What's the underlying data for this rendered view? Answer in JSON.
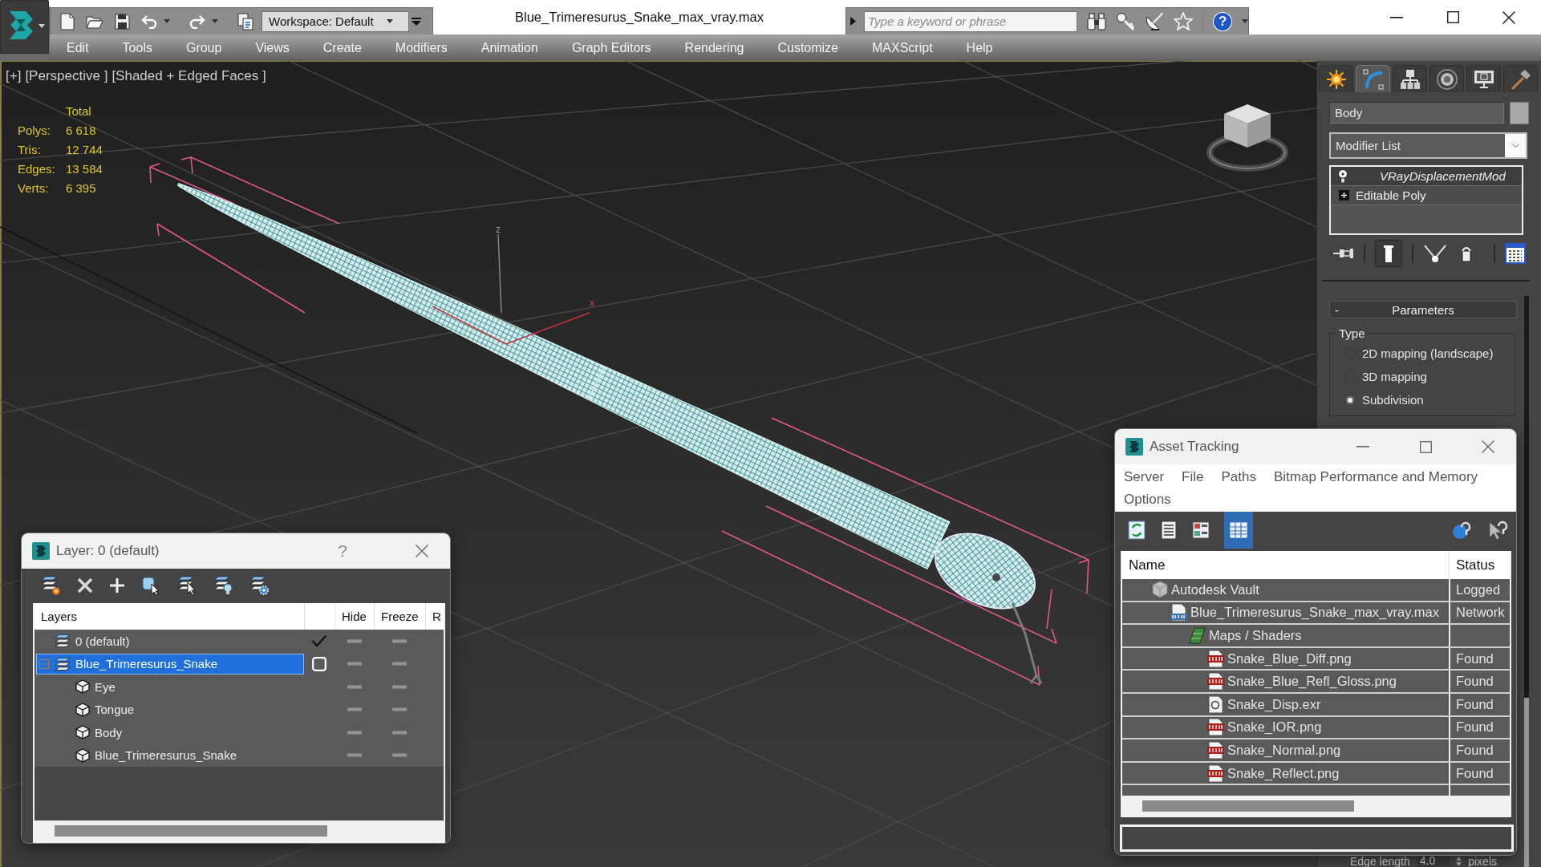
{
  "app": {
    "title": "Blue_Trimeresurus_Snake_max_vray.max",
    "workspace": "Workspace: Default",
    "search_placeholder": "Type a keyword or phrase",
    "help": "?"
  },
  "menu": [
    "Edit",
    "Tools",
    "Group",
    "Views",
    "Create",
    "Modifiers",
    "Animation",
    "Graph Editors",
    "Rendering",
    "Customize",
    "MAXScript",
    "Help"
  ],
  "viewport": {
    "labels": [
      "[+]",
      "[Perspective ]",
      "[Shaded + Edged Faces ]"
    ],
    "stats_header": "Total",
    "stats": [
      {
        "label": "Polys:",
        "value": "6 618"
      },
      {
        "label": "Tris:",
        "value": "12 744"
      },
      {
        "label": "Edges:",
        "value": "13 584"
      },
      {
        "label": "Verts:",
        "value": "6 395"
      }
    ],
    "axis_labels": [
      "z",
      "x"
    ]
  },
  "command_panel": {
    "tabs": [
      {
        "kind": "create",
        "selected": false
      },
      {
        "kind": "modify",
        "selected": true
      },
      {
        "kind": "hierarchy",
        "selected": false
      },
      {
        "kind": "motion",
        "selected": false
      },
      {
        "kind": "display",
        "selected": false
      },
      {
        "kind": "utilities",
        "selected": false
      }
    ],
    "object_name": "Body",
    "modifier_list": "Modifier List",
    "stack": [
      {
        "label": "VRayDisplacementMod",
        "kind": "modifier"
      },
      {
        "label": "Editable Poly",
        "kind": "base"
      }
    ],
    "rollout": {
      "toggle": "-",
      "title": "Parameters",
      "group": "Type",
      "options": [
        {
          "label": "2D mapping (landscape)",
          "selected": false
        },
        {
          "label": "3D mapping",
          "selected": false
        },
        {
          "label": "Subdivision",
          "selected": true
        }
      ]
    },
    "edge_length": {
      "label": "Edge length",
      "value": "4.0",
      "unit": "pixels"
    }
  },
  "layer_window": {
    "title": "Layer: 0 (default)",
    "help": "?",
    "columns": {
      "name": "Layers",
      "hide": "Hide",
      "freeze": "Freeze",
      "column_5": "R"
    },
    "layers": [
      {
        "name": "0 (default)",
        "kind": "layer",
        "current": true,
        "selected": false,
        "hidden": false,
        "frozen": false
      },
      {
        "name": "Blue_Trimeresurus_Snake",
        "kind": "layer",
        "current": false,
        "selected": true,
        "expanded": true,
        "hidden": false,
        "frozen": false,
        "children": [
          {
            "name": "Eye",
            "kind": "object",
            "selected": false,
            "hidden": false,
            "frozen": false
          },
          {
            "name": "Tongue",
            "kind": "object",
            "selected": false,
            "hidden": false,
            "frozen": false
          },
          {
            "name": "Body",
            "kind": "object",
            "selected": false,
            "hidden": false,
            "frozen": false
          },
          {
            "name": "Blue_Trimeresurus_Snake",
            "kind": "object",
            "selected": false,
            "hidden": false,
            "frozen": false
          }
        ]
      }
    ]
  },
  "asset_window": {
    "title": "Asset Tracking",
    "menu": [
      "Server",
      "File",
      "Paths",
      "Bitmap Performance and Memory",
      "Options"
    ],
    "toolbar": [
      {
        "kind": "refresh",
        "selected": false
      },
      {
        "kind": "list",
        "selected": false
      },
      {
        "kind": "thumbnails",
        "selected": false
      },
      {
        "kind": "table",
        "selected": true
      }
    ],
    "columns": {
      "name": "Name",
      "status": "Status"
    },
    "assets": [
      {
        "name": "Autodesk Vault",
        "status": "Logged",
        "kind": "vault",
        "children": [
          {
            "name": "Blue_Trimeresurus_Snake_max_vray.max",
            "status": "Network",
            "kind": "max",
            "children": [
              {
                "name": "Maps / Shaders",
                "kind": "maps",
                "children": [
                  {
                    "name": "Snake_Blue_Diff.png",
                    "status": "Found",
                    "kind": "png"
                  },
                  {
                    "name": "Snake_Blue_Refl_Gloss.png",
                    "status": "Found",
                    "kind": "png"
                  },
                  {
                    "name": "Snake_Disp.exr",
                    "status": "Found",
                    "kind": "exr"
                  },
                  {
                    "name": "Snake_IOR.png",
                    "status": "Found",
                    "kind": "png"
                  },
                  {
                    "name": "Snake_Normal.png",
                    "status": "Found",
                    "kind": "png"
                  },
                  {
                    "name": "Snake_Reflect.png",
                    "status": "Found",
                    "kind": "png"
                  }
                ]
              }
            ]
          }
        ]
      }
    ]
  }
}
